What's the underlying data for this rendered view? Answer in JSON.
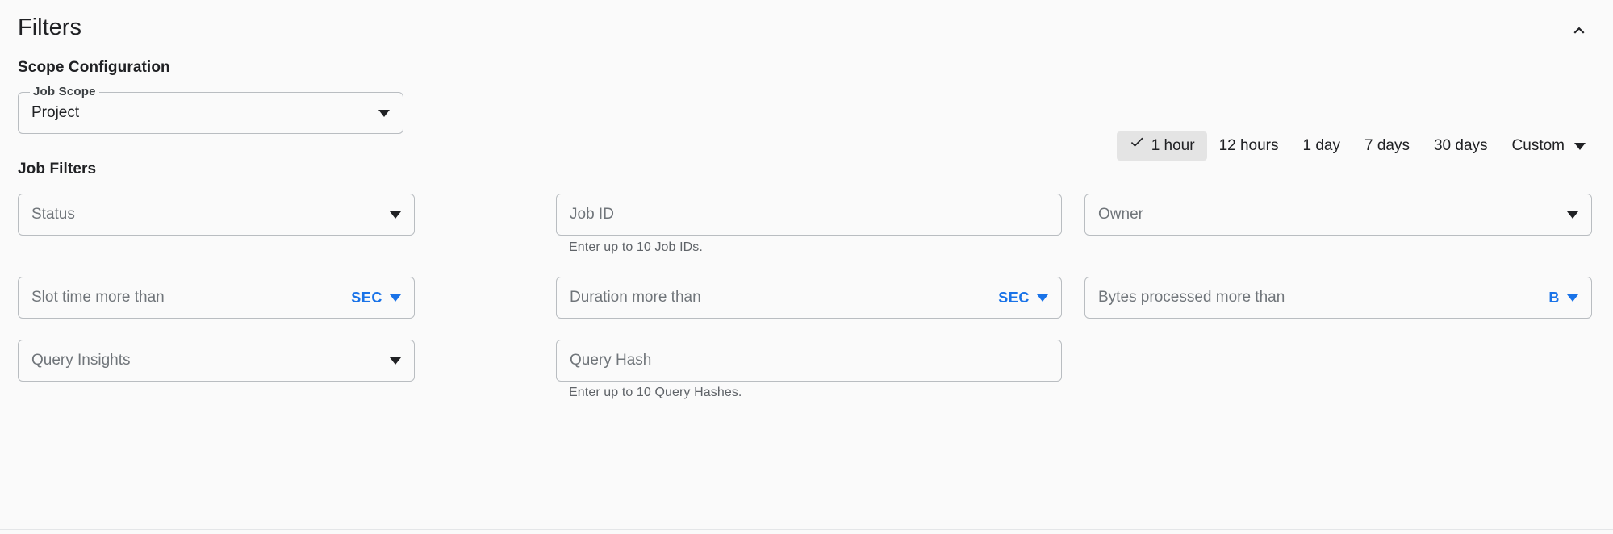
{
  "panel": {
    "title": "Filters",
    "collapse_icon": "chevron-up-icon"
  },
  "scope_section": {
    "heading": "Scope Configuration",
    "job_scope": {
      "label": "Job Scope",
      "value": "Project",
      "icon": "chevron-down-icon"
    }
  },
  "time_range": {
    "options": [
      {
        "label": "1 hour",
        "selected": true
      },
      {
        "label": "12 hours",
        "selected": false
      },
      {
        "label": "1 day",
        "selected": false
      },
      {
        "label": "7 days",
        "selected": false
      },
      {
        "label": "30 days",
        "selected": false
      }
    ],
    "custom": {
      "label": "Custom",
      "icon": "chevron-down-icon"
    },
    "check_icon": "check-icon",
    "selected_chip_bg": "#e4e4e4"
  },
  "job_filters": {
    "heading": "Job Filters",
    "row1": {
      "status": {
        "placeholder": "Status",
        "icon": "chevron-down-icon"
      },
      "job_id": {
        "placeholder": "Job ID",
        "helper": "Enter up to 10 Job IDs."
      },
      "owner": {
        "placeholder": "Owner",
        "icon": "chevron-down-icon"
      }
    },
    "row2": {
      "slot_time": {
        "placeholder": "Slot time more than",
        "unit": "SEC",
        "icon": "chevron-down-icon"
      },
      "duration": {
        "placeholder": "Duration more than",
        "unit": "SEC",
        "icon": "chevron-down-icon"
      },
      "bytes": {
        "placeholder": "Bytes processed more than",
        "unit": "B",
        "icon": "chevron-down-icon"
      }
    },
    "row3": {
      "query_insights": {
        "placeholder": "Query Insights",
        "icon": "chevron-down-icon"
      },
      "query_hash": {
        "placeholder": "Query Hash",
        "helper": "Enter up to 10 Query Hashes."
      }
    }
  },
  "colors": {
    "background": "#fafafa",
    "accent_blue": "#1a73e8",
    "field_border": "#b9bdc1",
    "placeholder": "#70757a",
    "text": "#202124",
    "helper": "#5f6368"
  }
}
